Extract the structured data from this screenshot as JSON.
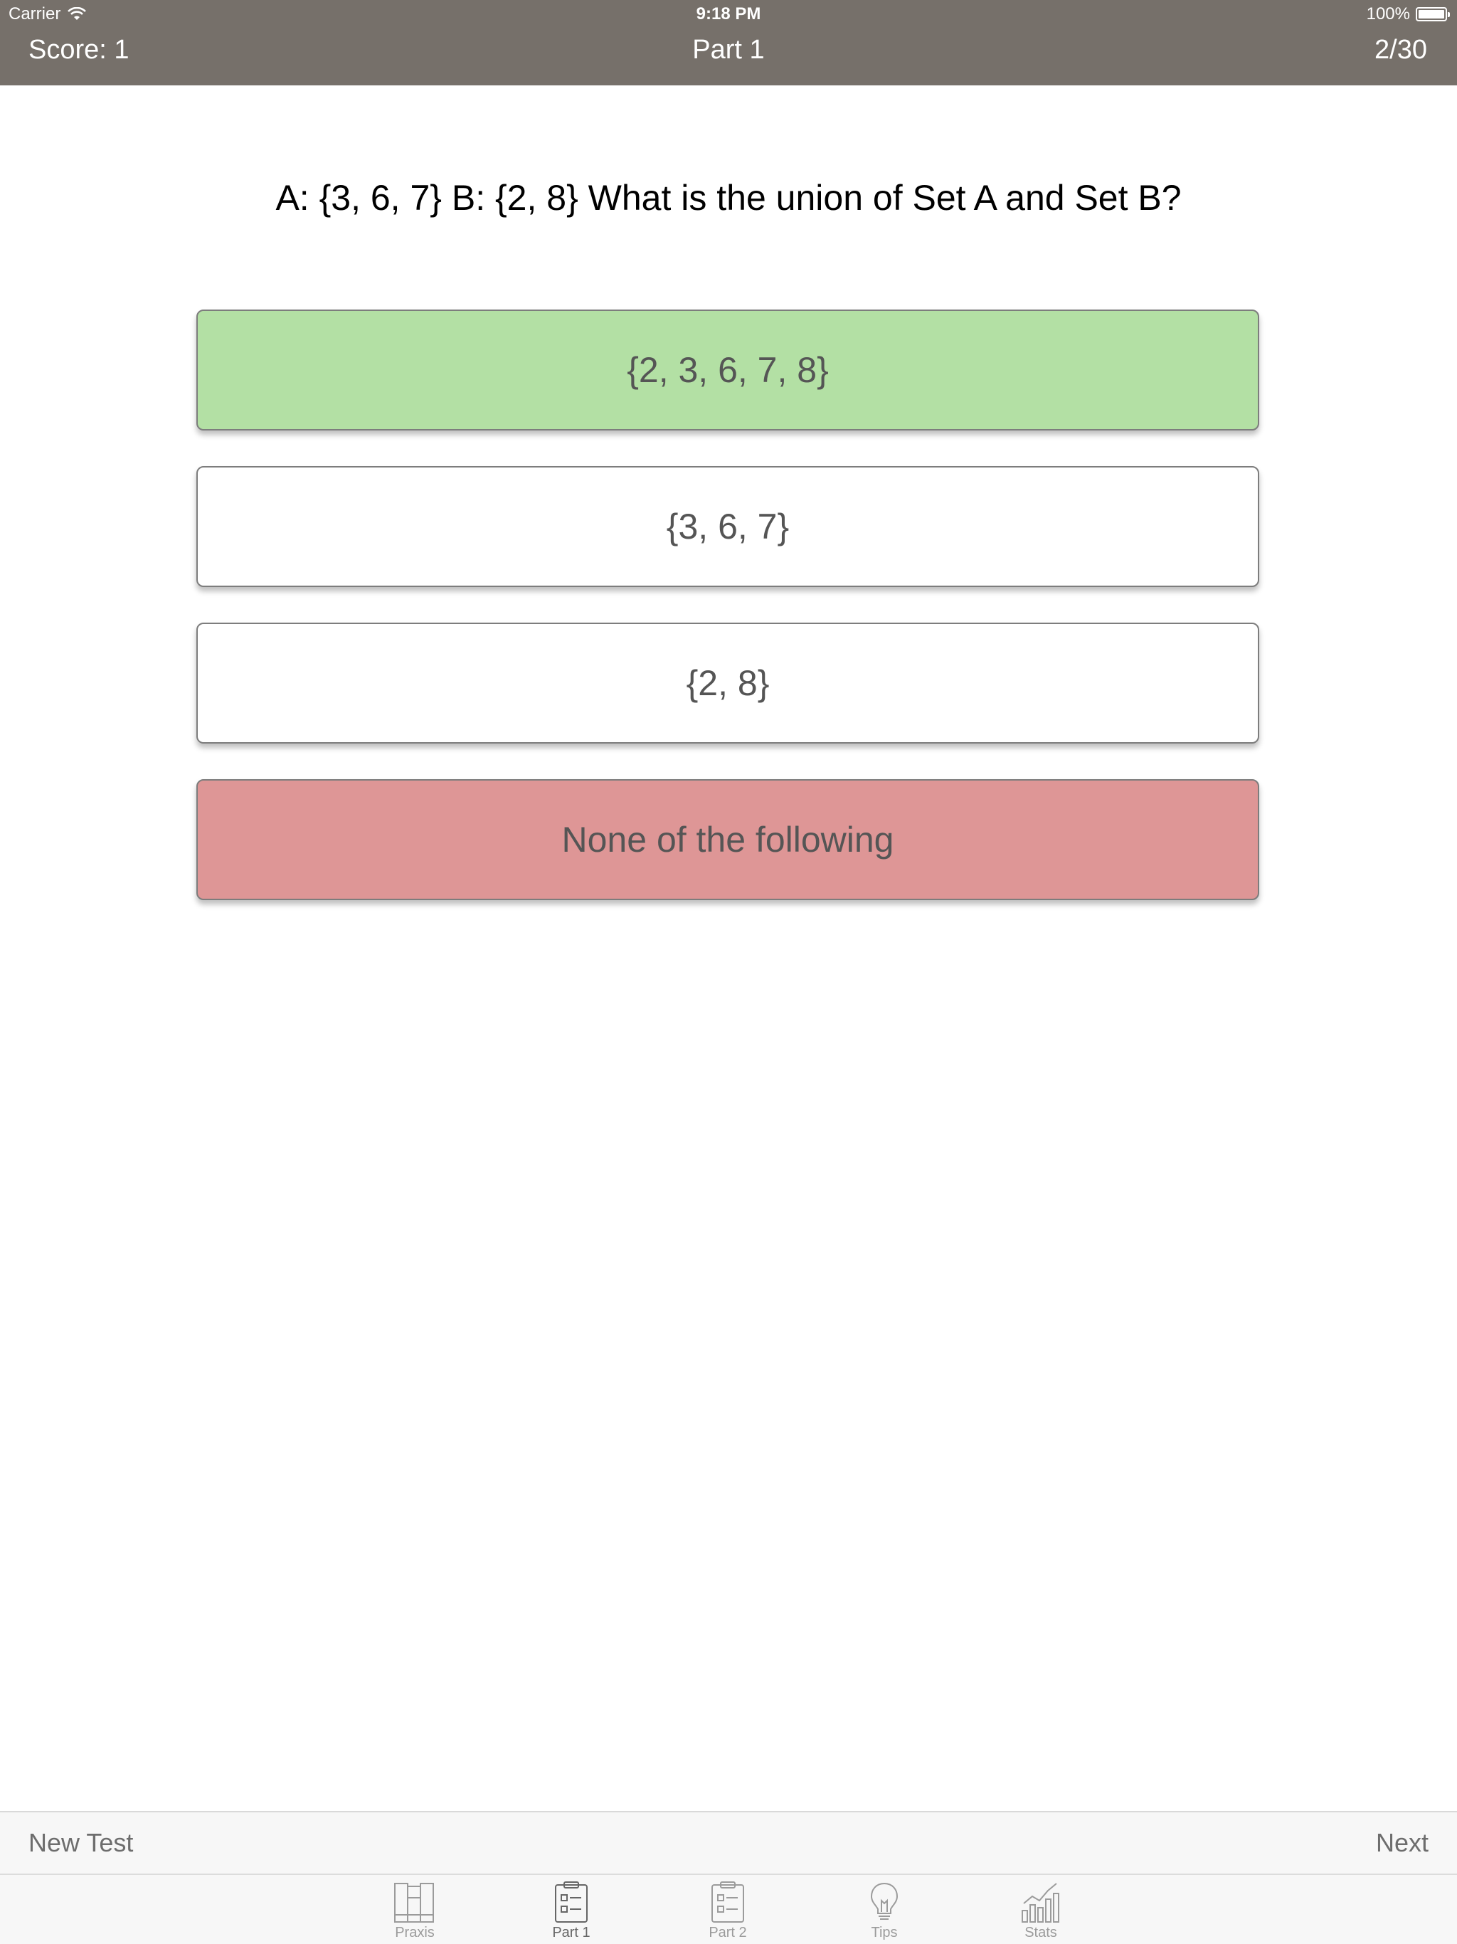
{
  "status_bar": {
    "carrier": "Carrier",
    "time": "9:18 PM",
    "battery": "100%"
  },
  "header": {
    "score": "Score: 1",
    "title": "Part 1",
    "progress": "2/30",
    "background_color": "#76706a"
  },
  "question": {
    "text": "A: {3, 6, 7} B: {2, 8} What is the union of Set A and Set B?"
  },
  "answers": [
    {
      "label": "{2, 3, 6, 7, 8}",
      "state": "correct",
      "color": "#b3e0a4"
    },
    {
      "label": "{3, 6, 7}",
      "state": "neutral",
      "color": "#ffffff"
    },
    {
      "label": "{2, 8}",
      "state": "neutral",
      "color": "#ffffff"
    },
    {
      "label": "None of the following",
      "state": "wrong",
      "color": "#de9696"
    }
  ],
  "toolbar": {
    "new_test": "New Test",
    "next": "Next"
  },
  "tabs": [
    {
      "label": "Praxis",
      "icon": "books-icon",
      "active": false
    },
    {
      "label": "Part 1",
      "icon": "clipboard-icon",
      "active": true
    },
    {
      "label": "Part 2",
      "icon": "clipboard-icon",
      "active": false
    },
    {
      "label": "Tips",
      "icon": "lightbulb-icon",
      "active": false
    },
    {
      "label": "Stats",
      "icon": "bar-chart-icon",
      "active": false
    }
  ]
}
